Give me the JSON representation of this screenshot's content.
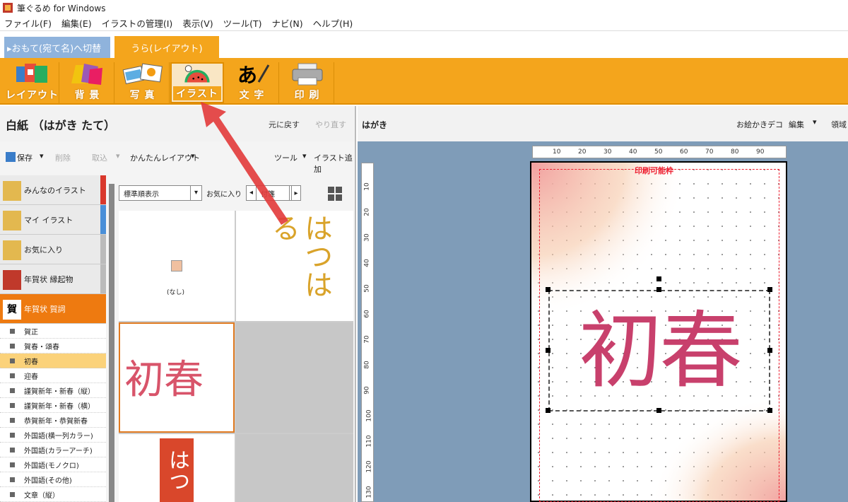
{
  "window": {
    "title": "筆ぐるめ for Windows"
  },
  "menubar": {
    "items": [
      "ファイル(F)",
      "編集(E)",
      "イラストの管理(I)",
      "表示(V)",
      "ツール(T)",
      "ナビ(N)",
      "ヘルプ(H)"
    ]
  },
  "modebar": {
    "omote_label": "▸おもて(宛て名)へ切替",
    "ura_label": "うら(レイアウト)"
  },
  "ribbon": {
    "buttons": [
      {
        "label": "レイアウト",
        "icon": "layout-icon"
      },
      {
        "label": "背 景",
        "icon": "background-icon"
      },
      {
        "label": "写 真",
        "icon": "photo-icon"
      },
      {
        "label": "イラスト",
        "icon": "illustration-icon",
        "active": true
      },
      {
        "label": "文 字",
        "icon": "text-icon"
      },
      {
        "label": "印 刷",
        "icon": "printer-icon"
      }
    ]
  },
  "leftpane": {
    "title": "白紙 （はがき たて）",
    "undo": "元に戻す",
    "redo": "やり直す",
    "toolbar": {
      "save": "保存",
      "delete": "削除",
      "import": "取込",
      "easy_layout": "かんたんレイアウト",
      "tools": "ツール",
      "add_illust": "イラスト追加"
    },
    "categories": [
      {
        "label": "みんなのイラスト",
        "color": "#d9382c"
      },
      {
        "label": "マイ イラスト",
        "color": "#4a8fd8"
      },
      {
        "label": "お気に入り",
        "color": "#bbbbbb"
      },
      {
        "label": "年賀状 縁起物",
        "color": "#bbbbbb"
      },
      {
        "label": "年賀状 賀詞",
        "color": "#ee7a10",
        "selected": true
      }
    ],
    "subitems": [
      "賀正",
      "賀春・頌春",
      "初春",
      "迎春",
      "謹賀新年・新春（縦）",
      "謹賀新年・新春（横）",
      "恭賀新年・恭賀新春",
      "外国語(横一列カラー)",
      "外国語(カラーアーチ)",
      "外国語(モノクロ)",
      "外国語(その他)",
      "文章（縦）"
    ],
    "selected_subitem": 2,
    "gallery": {
      "sort_label": "標準順表示",
      "favorite_label": "お気に入り",
      "tag_label": "付箋",
      "none_label": "(なし)",
      "thumb_hatsuharu": "はつはる",
      "thumb_shoshun": "初春",
      "thumb_hatsu_red": "はつ"
    }
  },
  "rightpane": {
    "title": "はがき",
    "deco": "お絵かきデコ",
    "edit": "編集",
    "area": "領域",
    "print_area": "印刷可能枠",
    "main_text": "初春"
  },
  "ruler": {
    "h_ticks": [
      "10",
      "20",
      "30",
      "40",
      "50",
      "60",
      "70",
      "80",
      "90"
    ],
    "v_ticks": [
      "10",
      "20",
      "30",
      "40",
      "50",
      "60",
      "70",
      "80",
      "90",
      "100",
      "110",
      "120",
      "130"
    ]
  },
  "colors": {
    "accent": "#f4a51c",
    "selected": "#ee7a10",
    "canvas_bg": "#7f9cb8"
  }
}
